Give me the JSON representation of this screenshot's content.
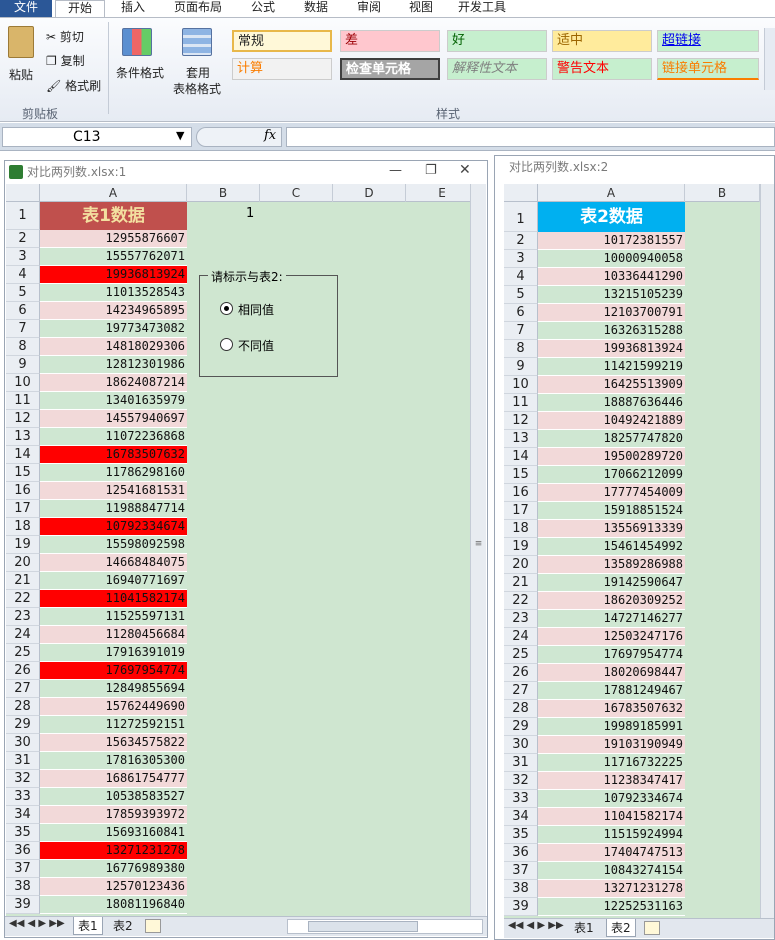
{
  "tabs": [
    "文件",
    "开始",
    "插入",
    "页面布局",
    "公式",
    "数据",
    "审阅",
    "视图",
    "开发工具"
  ],
  "clipboard": {
    "paste": "粘贴",
    "cut": "剪切",
    "copy": "复制",
    "format_painter": "格式刷",
    "label": "剪贴板"
  },
  "styles_group": {
    "conditional": "条件格式",
    "table_line1": "套用",
    "table_line2": "表格格式",
    "label": "样式"
  },
  "cell_styles": [
    {
      "text": "常规",
      "bg": "#fff8d8",
      "color": "#222"
    },
    {
      "text": "差",
      "bg": "#ffc7ce",
      "color": "#9c0006"
    },
    {
      "text": "好",
      "bg": "#c6efce",
      "color": "#006100"
    },
    {
      "text": "适中",
      "bg": "#ffeb9c",
      "color": "#9c6500"
    },
    {
      "text": "超链接",
      "bg": "#c6efce",
      "color": "#0000ee"
    },
    {
      "text": "计算",
      "bg": "#f2f2f2",
      "color": "#fa7d00"
    },
    {
      "text": "检查单元格",
      "bg": "#a5a5a5",
      "color": "#ffffff"
    },
    {
      "text": "解释性文本",
      "bg": "#c6efce",
      "color": "#7f7f7f"
    },
    {
      "text": "警告文本",
      "bg": "#c6efce",
      "color": "#ff0000"
    },
    {
      "text": "链接单元格",
      "bg": "#c6efce",
      "color": "#fa7d00"
    }
  ],
  "formula_bar": {
    "name_box": "C13",
    "fx": "fx",
    "formula": ""
  },
  "wb1": {
    "title": "对比两列数.xlsx:1",
    "columns": [
      "A",
      "B",
      "C",
      "D",
      "E"
    ],
    "header": "表1数据",
    "b1_value": "1",
    "group_box_label": "请标示与表2:",
    "radio_same": "相同值",
    "radio_diff": "不同值",
    "rows": [
      "2",
      "3",
      "4",
      "5",
      "6",
      "7",
      "8",
      "9",
      "10",
      "11",
      "12",
      "13",
      "14",
      "15",
      "16",
      "17",
      "18",
      "19",
      "20",
      "21",
      "22",
      "23",
      "24",
      "25",
      "26",
      "27",
      "28",
      "29",
      "30",
      "31",
      "32",
      "33",
      "34",
      "35",
      "36",
      "37",
      "38",
      "39"
    ],
    "values": [
      "12955876607",
      "15557762071",
      "19936813924",
      "11013528543",
      "14234965895",
      "19773473082",
      "14818029306",
      "12812301986",
      "18624087214",
      "13401635979",
      "14557940697",
      "11072236868",
      "16783507632",
      "11786298160",
      "12541681531",
      "11988847714",
      "10792334674",
      "15598092598",
      "14668484075",
      "16940771697",
      "11041582174",
      "11525597131",
      "11280456684",
      "17916391019",
      "17697954774",
      "12849855694",
      "15762449690",
      "11272592151",
      "15634575822",
      "17816305300",
      "16861754777",
      "10538583527",
      "17859393972",
      "15693160841",
      "13271231278",
      "16776989380",
      "12570123436",
      "18081196840"
    ],
    "highlight": [
      false,
      false,
      true,
      false,
      false,
      false,
      false,
      false,
      false,
      false,
      false,
      false,
      true,
      false,
      false,
      false,
      true,
      false,
      false,
      false,
      true,
      false,
      false,
      false,
      true,
      false,
      false,
      false,
      false,
      false,
      false,
      false,
      false,
      false,
      true,
      false,
      false,
      false
    ],
    "sheets": [
      "表1",
      "表2"
    ]
  },
  "wb2": {
    "title": "对比两列数.xlsx:2",
    "columns": [
      "A",
      "B"
    ],
    "header": "表2数据",
    "rows": [
      "2",
      "3",
      "4",
      "5",
      "6",
      "7",
      "8",
      "9",
      "10",
      "11",
      "12",
      "13",
      "14",
      "15",
      "16",
      "17",
      "18",
      "19",
      "20",
      "21",
      "22",
      "23",
      "24",
      "25",
      "26",
      "27",
      "28",
      "29",
      "30",
      "31",
      "32",
      "33",
      "34",
      "35",
      "36",
      "37",
      "38",
      "39"
    ],
    "values": [
      "10172381557",
      "10000940058",
      "10336441290",
      "13215105239",
      "12103700791",
      "16326315288",
      "19936813924",
      "11421599219",
      "16425513909",
      "18887636446",
      "10492421889",
      "18257747820",
      "19500289720",
      "17066212099",
      "17777454009",
      "15918851524",
      "13556913339",
      "15461454992",
      "13589286988",
      "19142590647",
      "18620309252",
      "14727146277",
      "12503247176",
      "17697954774",
      "18020698447",
      "17881249467",
      "16783507632",
      "19989185991",
      "19103190949",
      "11716732225",
      "11238347417",
      "10792334674",
      "11041582174",
      "11515924994",
      "17404747513",
      "10843274154",
      "13271231278",
      "12252531163"
    ],
    "sheets": [
      "表1",
      "表2"
    ]
  },
  "colors": {
    "header1": "#c0504d",
    "header2": "#00b0f0",
    "pink": "#f2d9d9",
    "green": "#cfe7d2",
    "red": "#ff0000",
    "sheet_bg": "#cfe6d0"
  }
}
